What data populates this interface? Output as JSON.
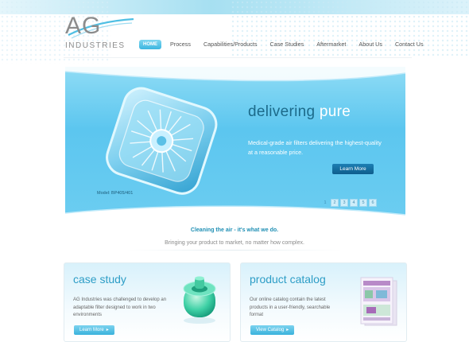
{
  "logo": {
    "letters": "AG",
    "subtitle": "INDUSTRIES"
  },
  "nav": {
    "items": [
      "HOME",
      "Process",
      "Capabilities/Products",
      "Case Studies",
      "Aftermarket",
      "About Us",
      "Contact Us"
    ],
    "active": "HOME"
  },
  "hero": {
    "tagline_part1": "delivering ",
    "tagline_part2": "pure",
    "description": "Medical-grade air filters delivering the highest-quality at a reasonable price.",
    "button": "Learn More",
    "model": "Model: BP405/401",
    "pages": [
      "1",
      "2",
      "3",
      "4",
      "5",
      "6"
    ],
    "current_page": "1"
  },
  "slogan": "Cleaning the air - it's what we do.",
  "subslogan": "Bringing your product to market, no matter how complex.",
  "case_study": {
    "title": "case study",
    "text": "AG Industries was challenged to develop an adaptable filter designed to work in two environments",
    "button": "Learn More"
  },
  "catalog": {
    "title": "product catalog",
    "text": "Our online catalog contain the latest products in a user-friendly, searchable format",
    "button": "View Catalog"
  },
  "colors": {
    "accent": "#3cb6e0",
    "hero": "#5cc6ef",
    "button_dark": "#0e5d8c"
  }
}
